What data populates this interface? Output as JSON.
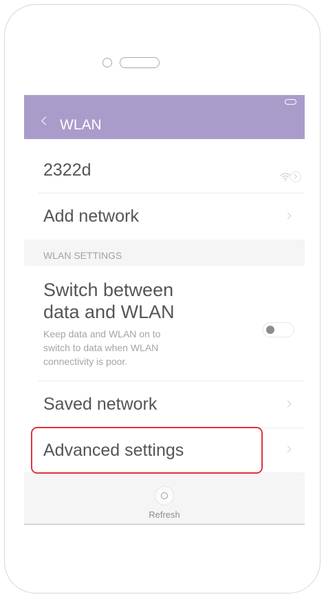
{
  "header": {
    "back_label": "<",
    "title": "WLAN"
  },
  "networks": {
    "current_network": "2322d",
    "add_network": "Add network"
  },
  "wlan_settings": {
    "section_title": "WLAN SETTINGS",
    "switch_title_line1": "Switch between",
    "switch_title_line2": "data and WLAN",
    "switch_desc_line1": "Keep data and WLAN on to",
    "switch_desc_line2": "switch to data when WLAN",
    "switch_desc_line3": "connectivity is poor.",
    "switch_state": "off",
    "saved_network": "Saved network",
    "advanced_settings": "Advanced settings"
  },
  "footer": {
    "refresh_label": "Refresh"
  },
  "colors": {
    "title_bar": "#a99ccb",
    "highlight": "#e0323f"
  },
  "icons": [
    "back-icon",
    "battery-icon",
    "wifi-icon",
    "info-icon",
    "chevron-right-icon",
    "refresh-icon"
  ]
}
